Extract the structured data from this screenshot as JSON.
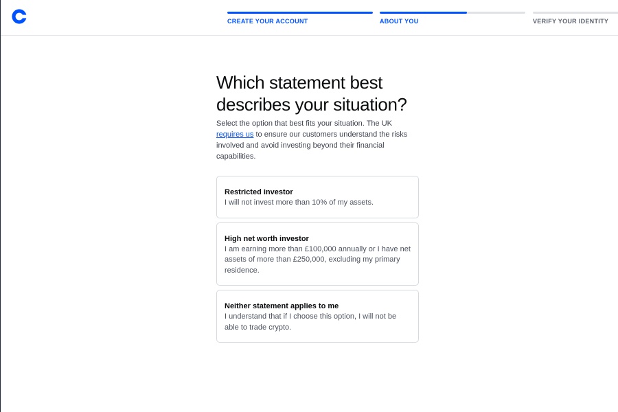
{
  "header": {
    "logo_icon": "coinbase-logo-icon",
    "accent_color": "#0052ff",
    "steps": [
      {
        "label": "CREATE YOUR ACCOUNT",
        "progress": 1.0,
        "state": "active"
      },
      {
        "label": "ABOUT YOU",
        "progress": 0.6,
        "state": "active"
      },
      {
        "label": "VERIFY YOUR IDENTITY",
        "progress": 0.0,
        "state": "inactive"
      }
    ]
  },
  "main": {
    "title": "Which statement best describes your situation?",
    "desc_before_link": "Select the option that best fits your situation. The UK ",
    "desc_link": "requires us",
    "desc_after_link": " to ensure our customers understand the risks involved and avoid investing beyond their financial capabilities.",
    "options": [
      {
        "title": "Restricted investor",
        "description": "I will not invest more than 10% of my assets."
      },
      {
        "title": "High net worth investor",
        "description": "I am earning more than £100,000 annually or I have net assets of more than £250,000, excluding my primary residence."
      },
      {
        "title": "Neither statement applies to me",
        "description": "I understand that if I choose this option, I will not be able to trade crypto."
      }
    ]
  }
}
